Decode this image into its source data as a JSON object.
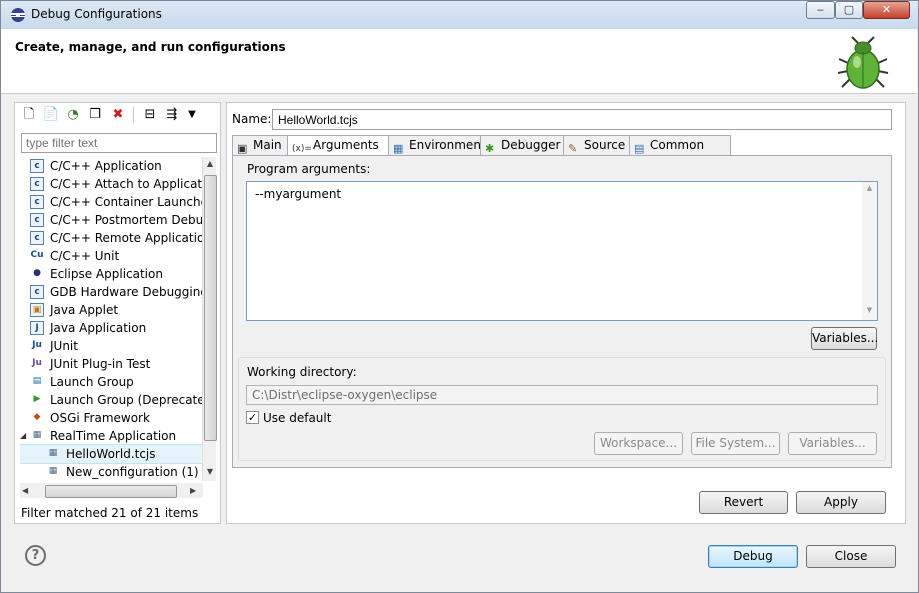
{
  "window": {
    "title": "Debug Configurations",
    "minimize": "‒",
    "maximize": "▢",
    "close": "✕"
  },
  "header": {
    "title": "Create, manage, and run configurations"
  },
  "filter": {
    "placeholder": "type filter text"
  },
  "tree": {
    "items": [
      {
        "label": "C/C++ Application",
        "icon": "c-icon",
        "glyph": "c"
      },
      {
        "label": "C/C++ Attach to Application",
        "icon": "c-icon",
        "glyph": "c"
      },
      {
        "label": "C/C++ Container Launcher",
        "icon": "c-icon",
        "glyph": "c"
      },
      {
        "label": "C/C++ Postmortem Debugger",
        "icon": "c-icon",
        "glyph": "c"
      },
      {
        "label": "C/C++ Remote Application",
        "icon": "c-icon",
        "glyph": "c"
      },
      {
        "label": "C/C++ Unit",
        "icon": "cu-icon",
        "glyph": "Cu"
      },
      {
        "label": "Eclipse Application",
        "icon": "eclipse-icon",
        "glyph": "●"
      },
      {
        "label": "GDB Hardware Debugging",
        "icon": "c-icon",
        "glyph": "c"
      },
      {
        "label": "Java Applet",
        "icon": "applet-icon",
        "glyph": "▣"
      },
      {
        "label": "Java Application",
        "icon": "java-icon",
        "glyph": "J"
      },
      {
        "label": "JUnit",
        "icon": "junit-icon",
        "glyph": "Ju"
      },
      {
        "label": "JUnit Plug-in Test",
        "icon": "junit-plugin-icon",
        "glyph": "Ju"
      },
      {
        "label": "Launch Group",
        "icon": "launch-group-icon",
        "glyph": "▤"
      },
      {
        "label": "Launch Group (Deprecated)",
        "icon": "launch-deprecated-icon",
        "glyph": "▶"
      },
      {
        "label": "OSGi Framework",
        "icon": "osgi-icon",
        "glyph": "◆"
      },
      {
        "label": "RealTime Application",
        "icon": "realtime-icon",
        "glyph": "▦"
      },
      {
        "label": "HelloWorld.tcjs",
        "icon": "config-icon",
        "glyph": "▦"
      },
      {
        "label": "New_configuration (1)",
        "icon": "config-icon",
        "glyph": "▦"
      }
    ]
  },
  "status": {
    "filter_matched": "Filter matched 21 of 21 items"
  },
  "config": {
    "name_label": "Name:",
    "name_value": "HelloWorld.tcjs",
    "tabs": [
      {
        "label": "Main",
        "icon": "main-tab-icon",
        "glyph": "▣"
      },
      {
        "label": "Arguments",
        "icon": "arguments-tab-icon",
        "glyph": "(x)="
      },
      {
        "label": "Environment",
        "icon": "environment-tab-icon",
        "glyph": "▦"
      },
      {
        "label": "Debugger",
        "icon": "debugger-tab-icon",
        "glyph": "✱"
      },
      {
        "label": "Source",
        "icon": "source-tab-icon",
        "glyph": "✎"
      },
      {
        "label": "Common",
        "icon": "common-tab-icon",
        "glyph": "▤"
      }
    ],
    "program_args_label": "Program arguments:",
    "program_args_value": "--myargument",
    "variables_button": "Variables...",
    "working_dir_label": "Working directory:",
    "working_dir_value": "C:\\Distr\\eclipse-oxygen\\eclipse",
    "use_default_label": "Use default",
    "workspace_button": "Workspace...",
    "filesystem_button": "File System...",
    "variables_button2": "Variables...",
    "revert_button": "Revert",
    "apply_button": "Apply"
  },
  "footer": {
    "help": "?",
    "debug_button": "Debug",
    "close_button": "Close"
  },
  "colors": {
    "titlebar": "#c7d9ec",
    "default_button": "#bee6fd",
    "close_caption": "#c6402a"
  }
}
